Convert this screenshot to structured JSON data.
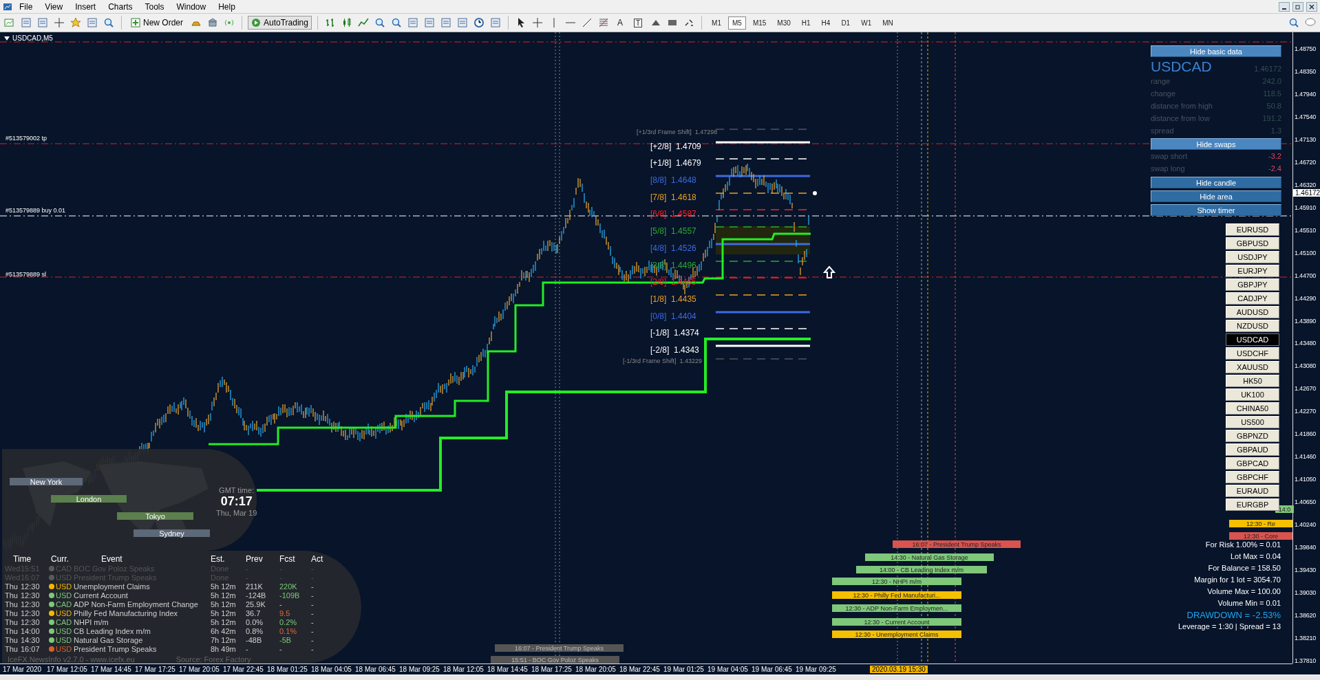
{
  "menu": [
    "File",
    "View",
    "Insert",
    "Charts",
    "Tools",
    "Window",
    "Help"
  ],
  "toolbar": {
    "buttons": [
      {
        "kind": "order",
        "label": "New Order"
      },
      {
        "kind": "auto",
        "label": "AutoTrading"
      }
    ],
    "drawing_tools": [
      "A",
      "T"
    ],
    "timeframes": [
      {
        "label": "M1",
        "selected": false
      },
      {
        "label": "M5",
        "selected": true
      },
      {
        "label": "M15",
        "selected": false
      },
      {
        "label": "M30",
        "selected": false
      },
      {
        "label": "H1",
        "selected": false
      },
      {
        "label": "H4",
        "selected": false
      },
      {
        "label": "D1",
        "selected": false
      },
      {
        "label": "W1",
        "selected": false
      },
      {
        "label": "MN",
        "selected": false
      }
    ]
  },
  "chart": {
    "title": "USDCAD,M5",
    "price_axis": [
      "1.48750",
      "1.48350",
      "1.47940",
      "1.47540",
      "1.47130",
      "1.46720",
      "1.46320",
      "1.45910",
      "1.45510",
      "1.45100",
      "1.44700",
      "1.44290",
      "1.43890",
      "1.43480",
      "1.43080",
      "1.42670",
      "1.42270",
      "1.41860",
      "1.41460",
      "1.41050",
      "1.40650",
      "1.40240",
      "1.39840",
      "1.39430",
      "1.39030",
      "1.38620",
      "1.38210",
      "1.37810"
    ],
    "current_price": "1.46172",
    "time_axis": [
      "17 Mar 2020",
      "17 Mar 12:05",
      "17 Mar 14:45",
      "17 Mar 17:25",
      "17 Mar 20:05",
      "17 Mar 22:45",
      "18 Mar 01:25",
      "18 Mar 04:05",
      "18 Mar 06:45",
      "18 Mar 09:25",
      "18 Mar 12:05",
      "18 Mar 14:45",
      "18 Mar 17:25",
      "18 Mar 20:05",
      "18 Mar 22:45",
      "19 Mar 01:25",
      "19 Mar 04:05",
      "19 Mar 06:45",
      "19 Mar 09:25"
    ],
    "time_marker": "2020.03.19 15:30",
    "order_lines": [
      {
        "kind": "tp",
        "label": "#513579002 tp"
      },
      {
        "kind": "entry",
        "label": "#513579889 buy 0.01"
      },
      {
        "kind": "sl",
        "label": "#513579889 sl"
      }
    ],
    "frame_shift_upper": {
      "label": "[+1/3rd Frame Shift]",
      "price": "1.47298"
    },
    "murrey_levels": [
      {
        "label": "[+2/8]",
        "price": "1.4709",
        "color": "#ffffff"
      },
      {
        "label": "[+1/8]",
        "price": "1.4679",
        "color": "#ffffff"
      },
      {
        "label": "[8/8]",
        "price": "1.4648",
        "color": "#3d6be0"
      },
      {
        "label": "[7/8]",
        "price": "1.4618",
        "color": "#f0a020"
      },
      {
        "label": "[6/8]",
        "price": "1.4587",
        "color": "#ff2020"
      },
      {
        "label": "[5/8]",
        "price": "1.4557",
        "color": "#2eaa2e"
      },
      {
        "label": "[4/8]",
        "price": "1.4526",
        "color": "#3d6be0"
      },
      {
        "label": "[3/8]",
        "price": "1.4496",
        "color": "#2eaa2e"
      },
      {
        "label": "[2/8]",
        "price": "1.4465",
        "color": "#ff2020"
      },
      {
        "label": "[1/8]",
        "price": "1.4435",
        "color": "#f0a020"
      },
      {
        "label": "[0/8]",
        "price": "1.4404",
        "color": "#3d6be0"
      },
      {
        "label": "[-1/8]",
        "price": "1.4374",
        "color": "#ffffff"
      },
      {
        "label": "[-2/8]",
        "price": "1.4343",
        "color": "#ffffff"
      }
    ],
    "frame_shift_lower": {
      "label": "[-1/3rd Frame Shift]",
      "price": "1.43229"
    },
    "calendar_bars": [
      {
        "text": "14:0",
        "color": "#7fc87a"
      },
      {
        "text": "12:30 - Re",
        "color": "#f5c000"
      },
      {
        "text": "12:30 - Core",
        "color": "#d9534f"
      },
      {
        "text": "16:07 - President Trump Speaks",
        "color": "#d9534f"
      },
      {
        "text": "14:30 - Natural Gas Storage",
        "color": "#7fc87a"
      },
      {
        "text": "14:00 - CB Leading Index m/m",
        "color": "#7fc87a"
      },
      {
        "text": "12:30 - NHPI m/m",
        "color": "#7fc87a"
      },
      {
        "text": "12:30 - Philly Fed Manufacturi...",
        "color": "#f5c000"
      },
      {
        "text": "12:30 - ADP Non-Farm Employmen...",
        "color": "#7fc87a"
      },
      {
        "text": "12:30 - Current Account",
        "color": "#7fc87a"
      },
      {
        "text": "12:30 - Unemployment Claims",
        "color": "#f5c000"
      },
      {
        "text": "16:07 - President Trump Speaks",
        "color": "#555555"
      },
      {
        "text": "15:51 - BOC Gov Poloz Speaks",
        "color": "#555555"
      }
    ]
  },
  "info_panel": {
    "hide_basic_button": "Hide basic data",
    "symbol": "USDCAD",
    "price": "1.46172",
    "stats": [
      {
        "label": "range",
        "value": "242.0"
      },
      {
        "label": "change",
        "value": "118.5"
      },
      {
        "label": "distance from high",
        "value": "50.8"
      },
      {
        "label": "distance from low",
        "value": "191.2"
      },
      {
        "label": "spread",
        "value": "1.3"
      }
    ],
    "hide_swaps_button": "Hide swaps",
    "swaps": [
      {
        "label": "swap short",
        "value": "-3.2"
      },
      {
        "label": "swap long",
        "value": "-2.4"
      }
    ],
    "buttons": [
      "Hide candle",
      "Hide area",
      "Show timer"
    ]
  },
  "symbols": [
    {
      "label": "EURUSD",
      "selected": false
    },
    {
      "label": "GBPUSD",
      "selected": false
    },
    {
      "label": "USDJPY",
      "selected": false
    },
    {
      "label": "EURJPY",
      "selected": false
    },
    {
      "label": "GBPJPY",
      "selected": false
    },
    {
      "label": "CADJPY",
      "selected": false
    },
    {
      "label": "AUDUSD",
      "selected": false
    },
    {
      "label": "NZDUSD",
      "selected": false
    },
    {
      "label": "USDCAD",
      "selected": true
    },
    {
      "label": "USDCHF",
      "selected": false
    },
    {
      "label": "XAUUSD",
      "selected": false
    },
    {
      "label": "HK50",
      "selected": false
    },
    {
      "label": "UK100",
      "selected": false
    },
    {
      "label": "CHINA50",
      "selected": false
    },
    {
      "label": "US500",
      "selected": false
    },
    {
      "label": "GBPNZD",
      "selected": false
    },
    {
      "label": "GBPAUD",
      "selected": false
    },
    {
      "label": "GBPCAD",
      "selected": false
    },
    {
      "label": "GBPCHF",
      "selected": false
    },
    {
      "label": "EURAUD",
      "selected": false
    },
    {
      "label": "EURGBP",
      "selected": false
    }
  ],
  "account_info": [
    "For Risk 1.00% = 0.01",
    "Lot Max = 0.04",
    "For Balance = 158.50",
    "Margin for 1 lot = 3054.70",
    "Volume Max = 100.00",
    "Volume Min = 0.01"
  ],
  "drawdown": "DRAWDOWN = -2.53%",
  "leverage": "Leverage = 1:30 | Spread = 13",
  "sessions": {
    "cities": [
      "New York",
      "London",
      "Tokyo",
      "Sydney"
    ],
    "gmt_label": "GMT time:",
    "time": "07:17",
    "date": "Thu, Mar 19"
  },
  "news": {
    "columns": [
      "Time",
      "Curr.",
      "Event",
      "Est.",
      "Prev",
      "Fcst",
      "Act"
    ],
    "rows": [
      {
        "day": "Wed",
        "time": "15:51",
        "color": "#5a5a5a",
        "currency": "CAD",
        "event": "BOC Gov Poloz Speaks",
        "est": "Done",
        "prev": "-",
        "fcst": {
          "text": "-"
        },
        "act": "-",
        "done": true
      },
      {
        "day": "Wed",
        "time": "16:07",
        "color": "#5a5a5a",
        "currency": "USD",
        "event": "President Trump Speaks",
        "est": "Done",
        "prev": "-",
        "fcst": {
          "text": "-"
        },
        "act": "-",
        "done": true
      },
      {
        "day": "Thu",
        "time": "12:30",
        "color": "#f5b800",
        "currency": "USD",
        "event": "Unemployment Claims",
        "est": "5h 12m",
        "prev": "211K",
        "fcst": {
          "text": "220K",
          "color": "#7fc87a"
        },
        "act": "-",
        "done": false
      },
      {
        "day": "Thu",
        "time": "12:30",
        "color": "#7fc87a",
        "currency": "USD",
        "event": "Current Account",
        "est": "5h 12m",
        "prev": "-124B",
        "fcst": {
          "text": "-109B",
          "color": "#7fc87a"
        },
        "act": "-",
        "done": false
      },
      {
        "day": "Thu",
        "time": "12:30",
        "color": "#7fc87a",
        "currency": "CAD",
        "event": "ADP Non-Farm Employment Change",
        "est": "5h 12m",
        "prev": "25.9K",
        "fcst": {
          "text": "-"
        },
        "act": "-",
        "done": false
      },
      {
        "day": "Thu",
        "time": "12:30",
        "color": "#f5b800",
        "currency": "USD",
        "event": "Philly Fed Manufacturing Index",
        "est": "5h 12m",
        "prev": "36.7",
        "fcst": {
          "text": "9.5",
          "color": "#e06b3a"
        },
        "act": "-",
        "done": false
      },
      {
        "day": "Thu",
        "time": "12:30",
        "color": "#7fc87a",
        "currency": "CAD",
        "event": "NHPI m/m",
        "est": "5h 12m",
        "prev": "0.0%",
        "fcst": {
          "text": "0.2%",
          "color": "#7fc87a"
        },
        "act": "-",
        "done": false
      },
      {
        "day": "Thu",
        "time": "14:00",
        "color": "#7fc87a",
        "currency": "USD",
        "event": "CB Leading Index m/m",
        "est": "6h 42m",
        "prev": "0.8%",
        "fcst": {
          "text": "0.1%",
          "color": "#e06b3a"
        },
        "act": "-",
        "done": false
      },
      {
        "day": "Thu",
        "time": "14:30",
        "color": "#7fc87a",
        "currency": "USD",
        "event": "Natural Gas Storage",
        "est": "7h 12m",
        "prev": "-48B",
        "fcst": {
          "text": "-5B",
          "color": "#7fc87a"
        },
        "act": "-",
        "done": false
      },
      {
        "day": "Thu",
        "time": "16:07",
        "color": "#d8602a",
        "currency": "USD",
        "event": "President Trump Speaks",
        "est": "8h 49m",
        "prev": "-",
        "fcst": {
          "text": "-"
        },
        "act": "-",
        "done": false
      }
    ],
    "footer": "IceFX NewsInfo v2.7.0  -  www.icefx.eu",
    "source": "Source: Forex Factory"
  }
}
